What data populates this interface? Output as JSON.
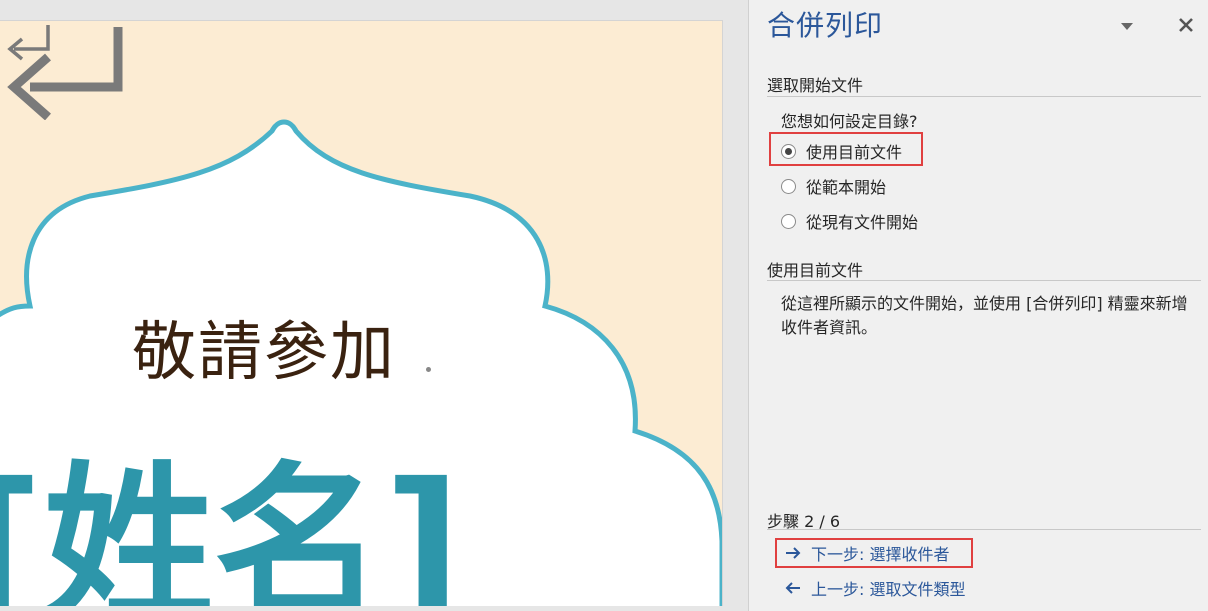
{
  "document": {
    "invite_text": "敬請參加",
    "name_field": "[姓名]"
  },
  "pane": {
    "title": "合併列印",
    "section1_heading": "選取開始文件",
    "question": "您想如何設定目錄?",
    "options": [
      {
        "label": "使用目前文件",
        "selected": true
      },
      {
        "label": "從範本開始",
        "selected": false
      },
      {
        "label": "從現有文件開始",
        "selected": false
      }
    ],
    "section2_heading": "使用目前文件",
    "description": "從這裡所顯示的文件開始，並使用 [合併列印] 精靈來新增收件者資訊。",
    "step_label": "步驟 2 / 6",
    "next_link": "下一步: 選擇收件者",
    "prev_link": "上一步: 選取文件類型"
  },
  "colors": {
    "accent": "#2b579a",
    "frame_blue": "#4bb3c9",
    "page_background": "#fcecd3",
    "name_text": "#2d96aa",
    "highlight": "#e04040"
  },
  "icons": {
    "options": "chevron-down-icon",
    "close": "close-icon",
    "next": "arrow-right-icon",
    "prev": "arrow-left-icon",
    "paragraph": "paragraph-mark-icon"
  }
}
